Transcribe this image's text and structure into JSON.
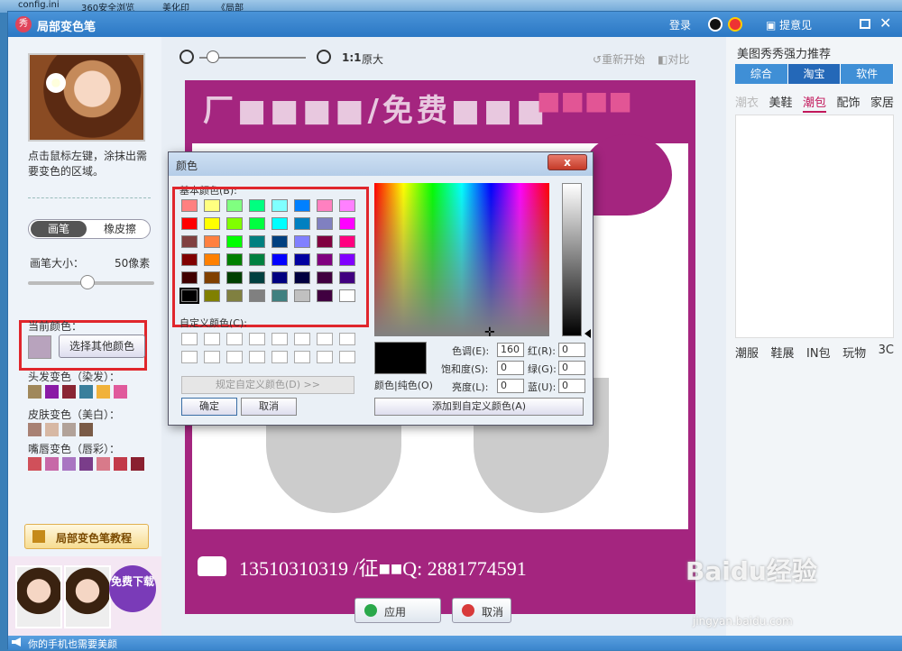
{
  "window": {
    "title": "局部变色笔",
    "login": "登录",
    "feedback": "提意见",
    "close": "✕"
  },
  "desktop": {
    "items": [
      "config.ini",
      "360安全浏览",
      "美化印",
      "《局部"
    ]
  },
  "left_panel": {
    "instruction": "点击鼠标左键，涂抹出需要变色的区域。",
    "mode_pen": "画笔",
    "mode_eraser": "橡皮擦",
    "brush_size_label": "画笔大小：",
    "brush_size_value": "50像素",
    "brush_size_level": 0.5,
    "current_color_label": "当前颜色：",
    "current_color": "#b8a3bd",
    "choose_color_button": "选择其他颜色",
    "hair_label": "头发变色（染发）：",
    "hair_colors": [
      "#a0885b",
      "#8a1aa6",
      "#8a2533",
      "#3a7f9c",
      "#f1b23a",
      "#e05a9c"
    ],
    "skin_label": "皮肤变色（美白）：",
    "skin_colors": [
      "#a88174",
      "#d7b8a4",
      "#b2a299",
      "#7a5b47"
    ],
    "lip_label": "嘴唇变色（唇彩）：",
    "lip_colors": [
      "#d0505a",
      "#c768a8",
      "#a975c2",
      "#7a3d8a",
      "#d87a8a",
      "#c23a4a",
      "#8a2030"
    ],
    "tutorial_button": "局部变色笔教程",
    "ad_button": "免费下载"
  },
  "toolbar": {
    "zoom_ratio": "1:1",
    "zoom_original": "原大",
    "restart": "重新开始",
    "compare": "对比"
  },
  "canvas": {
    "contact_text": "13510310319 /征■■Q: 2881774591"
  },
  "actions": {
    "apply": "应用",
    "cancel": "取消"
  },
  "right_panel": {
    "title": "美图秀秀强力推荐",
    "tabs": [
      {
        "label": "综合",
        "active": false
      },
      {
        "label": "淘宝",
        "active": true
      },
      {
        "label": "软件",
        "active": false
      }
    ],
    "sub_tabs_top": [
      {
        "label": "潮衣",
        "active": false
      },
      {
        "label": "美鞋",
        "active": false
      },
      {
        "label": "潮包",
        "active": true
      },
      {
        "label": "配饰",
        "active": false
      },
      {
        "label": "家居",
        "active": false
      }
    ],
    "sub_tabs_bottom": [
      "潮服",
      "鞋展",
      "IN包",
      "玩物",
      "3C"
    ]
  },
  "status": {
    "text": "你的手机也需要美颜"
  },
  "watermark": {
    "logo": "Baidu经验",
    "url": "jingyan.baidu.com"
  },
  "color_dialog": {
    "title": "颜色",
    "close": "x",
    "basic_colors_label": "基本颜色(B):",
    "basic_colors": [
      "#ff8080",
      "#ffff80",
      "#80ff80",
      "#00ff80",
      "#80ffff",
      "#0080ff",
      "#ff80c0",
      "#ff80ff",
      "#ff0000",
      "#ffff00",
      "#80ff00",
      "#00ff40",
      "#00ffff",
      "#0080c0",
      "#8080c0",
      "#ff00ff",
      "#804040",
      "#ff8040",
      "#00ff00",
      "#008080",
      "#004080",
      "#8080ff",
      "#800040",
      "#ff0080",
      "#800000",
      "#ff8000",
      "#008000",
      "#008040",
      "#0000ff",
      "#0000a0",
      "#800080",
      "#8000ff",
      "#400000",
      "#804000",
      "#004000",
      "#004040",
      "#000080",
      "#000040",
      "#400040",
      "#400080",
      "#000000",
      "#808000",
      "#808040",
      "#808080",
      "#408080",
      "#c0c0c0",
      "#400040",
      "#ffffff"
    ],
    "custom_colors_label": "自定义颜色(C):",
    "define_custom_button": "规定自定义颜色(D) >>",
    "ok_button": "确定",
    "cancel_button": "取消",
    "preview_label": "颜色|纯色(O)",
    "hue_label": "色调(E):",
    "hue_value": "160",
    "sat_label": "饱和度(S):",
    "sat_value": "0",
    "lum_label": "亮度(L):",
    "lum_value": "0",
    "red_label": "红(R):",
    "red_value": "0",
    "green_label": "绿(G):",
    "green_value": "0",
    "blue_label": "蓝(U):",
    "blue_value": "0",
    "add_custom_button": "添加到自定义颜色(A)"
  }
}
